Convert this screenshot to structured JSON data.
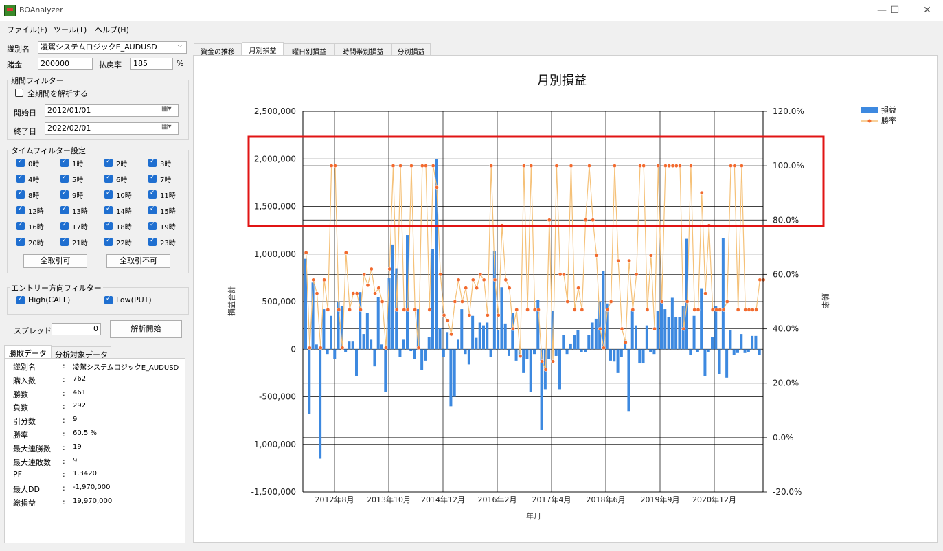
{
  "window": {
    "title": "BOAnalyzer",
    "min": "—",
    "max": "☐",
    "close": "✕"
  },
  "menu": [
    "ファイル(F)",
    "ツール(T)",
    "ヘルプ(H)"
  ],
  "left": {
    "id_label": "識別名",
    "id_value": "凌駕システムロジックE_AUDUSD",
    "bet_label": "賭金",
    "bet_value": "200000",
    "payout_label": "払戻率",
    "payout_value": "185",
    "payout_unit": "%",
    "period_title": "期間フィルター",
    "all_period_label": "全期間を解析する",
    "start_label": "開始日",
    "start_value": "2012/01/01",
    "end_label": "終了日",
    "end_value": "2022/02/01",
    "time_title": "タイムフィルター設定",
    "hours": [
      "0時",
      "1時",
      "2時",
      "3時",
      "4時",
      "5時",
      "6時",
      "7時",
      "8時",
      "9時",
      "10時",
      "11時",
      "12時",
      "13時",
      "14時",
      "15時",
      "16時",
      "17時",
      "18時",
      "19時",
      "20時",
      "21時",
      "22時",
      "23時"
    ],
    "btn_all_on": "全取引可",
    "btn_all_off": "全取引不可",
    "entry_title": "エントリー方向フィルター",
    "high_label": "High(CALL)",
    "low_label": "Low(PUT)",
    "spread_label": "スプレッド",
    "spread_value": "0",
    "analyze_btn": "解析開始",
    "tabs": [
      "勝敗データ",
      "分析対象データ"
    ],
    "stats": [
      {
        "k": "識別名",
        "v": "凌駕システムロジックE_AUDUSD"
      },
      {
        "k": "購入数",
        "v": "762"
      },
      {
        "k": "勝数",
        "v": "461"
      },
      {
        "k": "負数",
        "v": "292"
      },
      {
        "k": "引分数",
        "v": "9"
      },
      {
        "k": "勝率",
        "v": "60.5 %"
      },
      {
        "k": "最大連勝数",
        "v": "19"
      },
      {
        "k": "最大連敗数",
        "v": "9"
      },
      {
        "k": "PF",
        "v": "1.3420"
      },
      {
        "k": "最大DD",
        "v": "-1,970,000"
      },
      {
        "k": "総損益",
        "v": "19,970,000"
      }
    ],
    "colon": ":"
  },
  "right_tabs": [
    "資金の推移",
    "月別損益",
    "曜日別損益",
    "時間帯別損益",
    "分別損益"
  ],
  "colors": {
    "bar": "#3d89e0",
    "line": "#f5c178",
    "marker": "#f26a2e",
    "highlight": "#e11414"
  },
  "chart_data": {
    "type": "bar",
    "title": "月別損益",
    "xlabel": "年月",
    "ylabel": "損益合計",
    "y2label": "勝率",
    "ylim": [
      -1500000,
      2500000
    ],
    "y_ticks": [
      "-1,500,000",
      "-1,000,000",
      "-500,000",
      "0",
      "500,000",
      "1,000,000",
      "1,500,000",
      "2,000,000",
      "2,500,000"
    ],
    "y2lim": [
      -20,
      120
    ],
    "y2_ticks": [
      "-20.0%",
      "0.0%",
      "20.0%",
      "40.0%",
      "60.0%",
      "80.0%",
      "100.0%",
      "120.0%"
    ],
    "x_ticks": [
      "2012年8月",
      "2013年10月",
      "2014年12月",
      "2016年2月",
      "2017年4月",
      "2018年6月",
      "2019年9月",
      "2020年12月"
    ],
    "legend": [
      "損益",
      "勝率"
    ],
    "legend_position": "top-right",
    "series": [
      {
        "name": "損益",
        "values": [
          950000,
          -680000,
          700000,
          50000,
          -1150000,
          420000,
          -50000,
          350000,
          -100000,
          500000,
          450000,
          -30000,
          80000,
          80000,
          -280000,
          600000,
          160000,
          380000,
          100000,
          -180000,
          550000,
          50000,
          -450000,
          750000,
          1100000,
          850000,
          -80000,
          100000,
          1200000,
          -20000,
          -100000,
          420000,
          -220000,
          -120000,
          130000,
          1050000,
          2000000,
          220000,
          -80000,
          180000,
          -600000,
          -500000,
          100000,
          420000,
          -50000,
          -160000,
          350000,
          120000,
          280000,
          250000,
          280000,
          -80000,
          1030000,
          200000,
          650000,
          270000,
          -70000,
          380000,
          -120000,
          -80000,
          -250000,
          -100000,
          -450000,
          -50000,
          520000,
          -850000,
          -420000,
          -100000,
          400000,
          -70000,
          -420000,
          150000,
          -50000,
          60000,
          150000,
          200000,
          -30000,
          -30000,
          150000,
          280000,
          320000,
          500000,
          820000,
          480000,
          -120000,
          -130000,
          -250000,
          -80000,
          100000,
          -650000,
          400000,
          250000,
          -150000,
          -150000,
          250000,
          -30000,
          -50000,
          400000,
          520000,
          420000,
          340000,
          540000,
          340000,
          340000,
          450000,
          1160000,
          -60000,
          350000,
          -30000,
          640000,
          -280000,
          -30000,
          130000,
          450000,
          -260000,
          1170000,
          -300000,
          200000,
          -60000,
          -40000,
          160000,
          -40000,
          -30000,
          140000,
          140000,
          -60000
        ]
      },
      {
        "name": "勝率",
        "values": [
          68,
          33,
          58,
          53,
          33,
          58,
          47,
          100,
          100,
          47,
          33,
          68,
          47,
          53,
          53,
          47,
          60,
          56,
          62,
          53,
          55,
          50,
          33,
          62,
          100,
          47,
          100,
          47,
          47,
          100,
          47,
          33,
          100,
          100,
          47,
          100,
          92,
          60,
          45,
          43,
          38,
          50,
          58,
          50,
          55,
          45,
          58,
          55,
          60,
          58,
          45,
          100,
          58,
          45,
          78,
          58,
          55,
          40,
          47,
          30,
          100,
          47,
          100,
          47,
          47,
          28,
          25,
          80,
          28,
          100,
          60,
          60,
          50,
          100,
          47,
          55,
          47,
          80,
          100,
          80,
          67,
          40,
          33,
          47,
          50,
          100,
          65,
          40,
          35,
          65,
          47,
          60,
          100,
          100,
          47,
          67,
          40,
          100,
          50,
          100,
          100,
          100,
          100,
          100,
          40,
          50,
          100,
          47,
          47,
          90,
          53,
          78,
          47,
          47,
          47,
          47,
          50,
          100,
          100,
          47,
          100,
          47,
          47,
          47,
          47,
          58,
          58
        ]
      }
    ]
  }
}
